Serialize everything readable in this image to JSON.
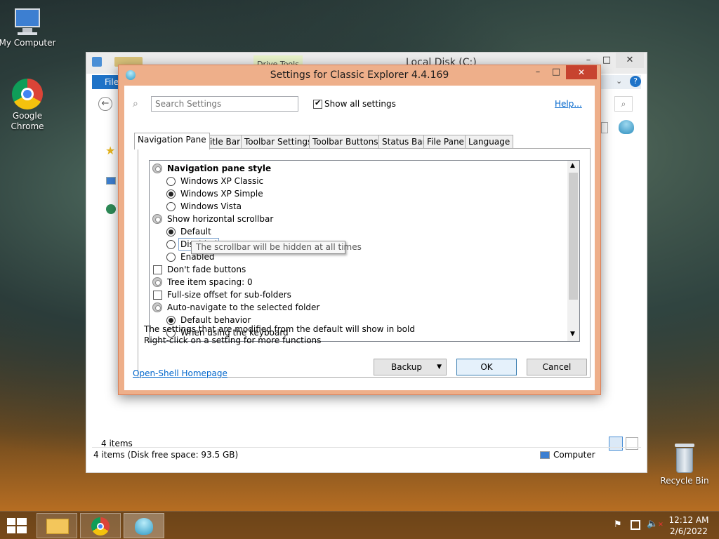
{
  "desktop": {
    "icons": [
      {
        "label": "My Computer"
      },
      {
        "label": "Google Chrome"
      },
      {
        "label": "Recycle Bin"
      }
    ]
  },
  "explorer": {
    "title": "Local Disk (C:)",
    "tab_context": "Drive Tools",
    "ribbon_file": "File",
    "items_count": "4 items",
    "status_left": "4 items (Disk free space: 93.5 GB)",
    "status_right": "Computer",
    "window_controls": {
      "minimize": "–",
      "maximize": "□",
      "close": "✕"
    }
  },
  "dialog": {
    "title": "Settings for Classic Explorer 4.4.169",
    "controls": {
      "minimize": "–",
      "maximize": "□",
      "close": "✕"
    },
    "search_placeholder": "Search Settings",
    "show_all_label": "Show all settings",
    "show_all_checked": true,
    "help_link": "Help...",
    "tabs": [
      "Navigation Pane",
      "Title Bar",
      "Toolbar Settings",
      "Toolbar Buttons",
      "Status Bar",
      "File Pane",
      "Language"
    ],
    "active_tab": "Navigation Pane",
    "settings": [
      {
        "label": "Navigation pane style",
        "kind": "group",
        "bold": true
      },
      {
        "label": "Windows XP Classic",
        "kind": "radio",
        "checked": false
      },
      {
        "label": "Windows XP Simple",
        "kind": "radio",
        "checked": true
      },
      {
        "label": "Windows Vista",
        "kind": "radio",
        "checked": false
      },
      {
        "label": "Show horizontal scrollbar",
        "kind": "group",
        "bold": false
      },
      {
        "label": "Default",
        "kind": "radio",
        "checked": true
      },
      {
        "label": "Disabled",
        "kind": "radio",
        "checked": false,
        "focused": true
      },
      {
        "label": "Enabled",
        "kind": "radio",
        "checked": false
      },
      {
        "label": "Don't fade buttons",
        "kind": "checkbox",
        "checked": false
      },
      {
        "label": "Tree item spacing: 0",
        "kind": "group",
        "bold": false
      },
      {
        "label": "Full-size offset for sub-folders",
        "kind": "checkbox",
        "checked": false
      },
      {
        "label": "Auto-navigate to the selected folder",
        "kind": "group",
        "bold": false
      },
      {
        "label": "Default behavior",
        "kind": "radio",
        "checked": true
      },
      {
        "label": "When using the keyboard",
        "kind": "radio",
        "checked": false
      }
    ],
    "tooltip": "The scrollbar will be hidden at all times",
    "note_line1": "The settings that are modified from the default will show in bold",
    "note_line2": "Right-click on a setting for more functions",
    "homepage_link": "Open-Shell Homepage",
    "backup_label": "Backup",
    "ok_label": "OK",
    "cancel_label": "Cancel"
  },
  "taskbar": {
    "time": "12:12 AM",
    "date": "2/6/2022"
  }
}
